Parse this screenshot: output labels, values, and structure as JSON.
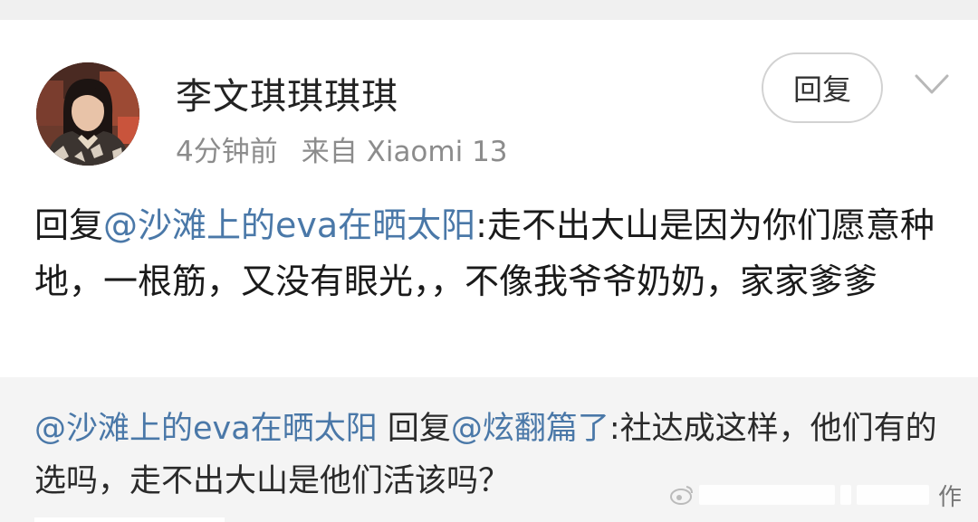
{
  "comment": {
    "username": "李文琪琪琪琪",
    "time": "4分钟前",
    "source": "来自 Xiaomi 13",
    "reply_button_label": "回复",
    "body_prefix": "回复",
    "body_mention": "@沙滩上的eva在晒太阳",
    "body_text": ":走不出大山是因为你们愿意种地，一根筋，又没有眼光，，不像我爷爷奶奶，家家爹爹"
  },
  "quoted": {
    "mention1": "@沙滩上的eva在晒太阳",
    "middle": " 回复",
    "mention2": "@炫翻篇了",
    "text": ":社达成这样，他们有的选吗，走不出大山是他们活该吗？"
  },
  "watermark": {
    "text": "作"
  },
  "colors": {
    "mention": "#4a78a8",
    "background": "#f2f2f2",
    "card": "#ffffff"
  },
  "icons": {
    "avatar": "user-avatar-photo",
    "more": "chevron-down-icon"
  }
}
